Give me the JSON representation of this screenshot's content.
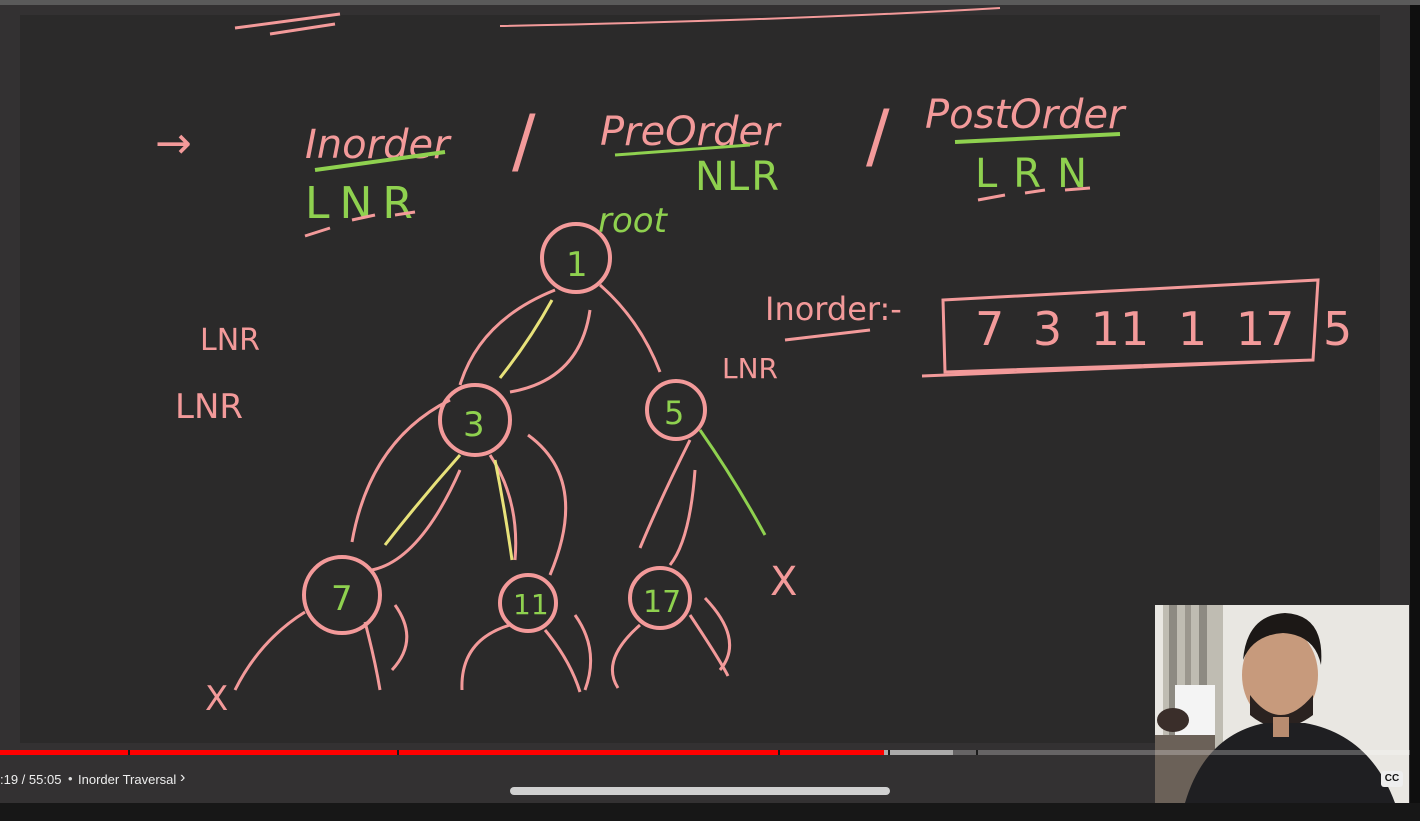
{
  "board": {
    "heading_arrow": "→",
    "inorder_title": "Inorder",
    "inorder_code": "LNR",
    "separator1": "/",
    "preorder_title": "PreOrder",
    "preorder_code": "NLR",
    "separator2": "/",
    "postorder_title": "PostOrder",
    "postorder_code": "LRN",
    "root_label": "root",
    "left_note_1": "LNR",
    "left_note_2": "LNR",
    "result_label": "Inorder:-",
    "result_sequence": "7 3 11 1 17 5",
    "side_note": "LNR",
    "tree_nodes": [
      "1",
      "3",
      "5",
      "7",
      "11",
      "17"
    ],
    "null_mark": "X"
  },
  "player": {
    "time_display": ":19 / 55:05",
    "separator_dot": "•",
    "chapter_title": "Inorder Traversal",
    "chapter_chevron": "›",
    "cc_label": "CC",
    "progress_played_fraction": 0.627,
    "progress_buffered_fraction": 0.676
  },
  "colors": {
    "accent_red": "#ff0000",
    "chalk_pink": "#f39a9a",
    "chalk_green": "#8fd14f",
    "chalk_yellow": "#e8e27a",
    "board_bg": "#2b2a2a"
  }
}
